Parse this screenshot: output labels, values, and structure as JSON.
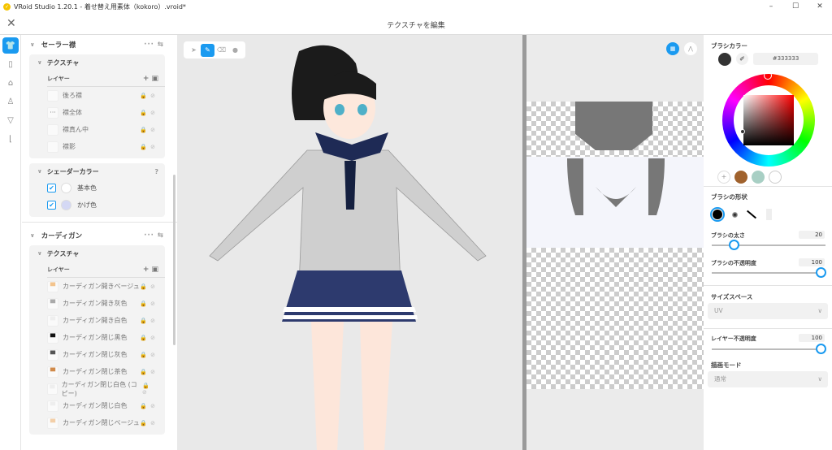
{
  "window": {
    "title": "VRoid Studio 1.20.1 - 着せ替え用素体（kokoro）.vroid*",
    "minimize": "–",
    "maximize": "☐",
    "close": "✕"
  },
  "header": {
    "title": "テクスチャを編集",
    "close": "✕"
  },
  "left": {
    "sections": [
      {
        "title": "セーラー襟",
        "texture_label": "テクスチャ",
        "layer_label": "レイヤー",
        "layers": [
          "後ろ襟",
          "襟全体",
          "襟真ん中",
          "襟影"
        ],
        "shader": {
          "title": "シェーダーカラー",
          "items": [
            {
              "label": "基本色",
              "color": "#ffffff",
              "checked": true
            },
            {
              "label": "かげ色",
              "color": "#d4d8f4",
              "checked": true
            }
          ]
        }
      },
      {
        "title": "カーディガン",
        "texture_label": "テクスチャ",
        "layer_label": "レイヤー",
        "layers": [
          {
            "label": "カーディガン開きベージュ",
            "color": "#f3c48e"
          },
          {
            "label": "カーディガン開き灰色",
            "color": "#aaaaaa"
          },
          {
            "label": "カーディガン開き白色",
            "color": "#eeeeee"
          },
          {
            "label": "カーディガン閉じ黒色",
            "color": "#111111"
          },
          {
            "label": "カーディガン閉じ灰色",
            "color": "#555555"
          },
          {
            "label": "カーディガン閉じ茶色",
            "color": "#d08a4a"
          },
          {
            "label": "カーディガン閉じ白色 (コピー)",
            "color": "#eeeeee"
          },
          {
            "label": "カーディガン閉じ白色",
            "color": "#eeeeee"
          },
          {
            "label": "カーディガン閉じベージュ",
            "color": "#f3cfa8"
          }
        ]
      }
    ]
  },
  "right": {
    "brush_color_label": "ブラシカラー",
    "hex": "#333333",
    "current_color": "#333333",
    "swatches": [
      "#a0622d",
      "#a8cfc4",
      "#ffffff"
    ],
    "brush_shape_label": "ブラシの形状",
    "brush_size_label": "ブラシの太さ",
    "brush_size": 20,
    "brush_opacity_label": "ブラシの不透明度",
    "brush_opacity": 100,
    "size_space_label": "サイズスペース",
    "size_space": "UV",
    "layer_opacity_label": "レイヤー不透明度",
    "layer_opacity": 100,
    "draw_mode_label": "描画モード",
    "draw_mode": "通常"
  },
  "colors": {
    "accent": "#1a9af0"
  }
}
